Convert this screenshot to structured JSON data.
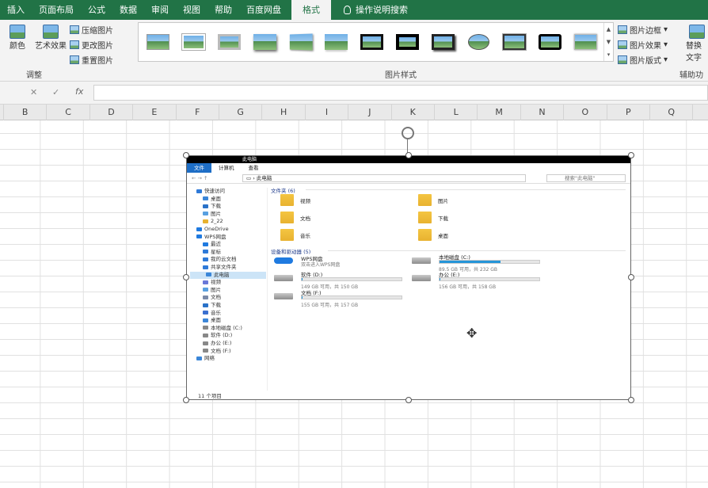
{
  "ribbon_tabs": [
    "插入",
    "页面布局",
    "公式",
    "数据",
    "审阅",
    "视图",
    "帮助",
    "百度网盘",
    "格式",
    "操作说明搜索"
  ],
  "active_tab_index": 8,
  "ribbon": {
    "adjust": {
      "color": "颜色",
      "art": "艺术效果",
      "compress": "压缩图片",
      "change": "更改图片",
      "reset": "重置图片",
      "label": "调整"
    },
    "styles_label": "图片样式",
    "right": {
      "border": "图片边框",
      "effects": "图片效果",
      "layout": "图片版式",
      "alt_text": "替换文字",
      "acc_label": "辅助功能"
    }
  },
  "formula_bar": {
    "fx": "fx",
    "cancel": "✕",
    "enter": "✓"
  },
  "columns": [
    "B",
    "C",
    "D",
    "E",
    "F",
    "G",
    "H",
    "I",
    "J",
    "K",
    "L",
    "M",
    "N",
    "O",
    "P",
    "Q",
    "R"
  ],
  "explorer": {
    "title": "此电脑",
    "tabs": [
      "文件",
      "计算机",
      "查看"
    ],
    "address": "此电脑",
    "search_placeholder": "搜索\"此电脑\"",
    "nav": [
      {
        "label": "快速访问",
        "indent": 0,
        "icon": "star-icon"
      },
      {
        "label": "桌面",
        "indent": 1,
        "icon": "desktop-icon"
      },
      {
        "label": "下载",
        "indent": 1,
        "icon": "download-icon"
      },
      {
        "label": "图片",
        "indent": 1,
        "icon": "pictures-icon"
      },
      {
        "label": "2_22",
        "indent": 1,
        "icon": "folder-icon"
      },
      {
        "label": "OneDrive",
        "indent": 0,
        "icon": "cloud-icon"
      },
      {
        "label": "WPS网盘",
        "indent": 0,
        "icon": "cloud-icon"
      },
      {
        "label": "最近",
        "indent": 1,
        "icon": "recent-icon"
      },
      {
        "label": "星标",
        "indent": 1,
        "icon": "star-icon"
      },
      {
        "label": "我的云文档",
        "indent": 1,
        "icon": "cloud-doc-icon"
      },
      {
        "label": "共享文件夹",
        "indent": 1,
        "icon": "share-icon"
      },
      {
        "label": "此电脑",
        "indent": 0,
        "icon": "pc-icon",
        "selected": true
      },
      {
        "label": "视频",
        "indent": 1,
        "icon": "video-icon"
      },
      {
        "label": "图片",
        "indent": 1,
        "icon": "pictures-icon"
      },
      {
        "label": "文档",
        "indent": 1,
        "icon": "documents-icon"
      },
      {
        "label": "下载",
        "indent": 1,
        "icon": "download-icon"
      },
      {
        "label": "音乐",
        "indent": 1,
        "icon": "music-icon"
      },
      {
        "label": "桌面",
        "indent": 1,
        "icon": "desktop-icon"
      },
      {
        "label": "本地磁盘 (C:)",
        "indent": 1,
        "icon": "drive-icon"
      },
      {
        "label": "软件 (D:)",
        "indent": 1,
        "icon": "drive-icon"
      },
      {
        "label": "办公 (E:)",
        "indent": 1,
        "icon": "drive-icon"
      },
      {
        "label": "文档 (F:)",
        "indent": 1,
        "icon": "drive-icon"
      },
      {
        "label": "网络",
        "indent": 0,
        "icon": "network-icon"
      }
    ],
    "folders_header": "文件夹 (6)",
    "folders": [
      "视频",
      "图片",
      "文档",
      "下载",
      "音乐",
      "桌面"
    ],
    "devices_header": "设备和驱动器 (5)",
    "drives": [
      {
        "name": "WPS网盘",
        "sub": "双击进入WPS网盘",
        "fill": 0,
        "bar": false
      },
      {
        "name": "本地磁盘 (C:)",
        "sub": "89.5 GB 可用，共 232 GB",
        "fill": 0.61,
        "bar": true
      },
      {
        "name": "软件 (D:)",
        "sub": "149 GB 可用，共 150 GB",
        "fill": 0.01,
        "bar": true
      },
      {
        "name": "办公 (E:)",
        "sub": "156 GB 可用，共 158 GB",
        "fill": 0.01,
        "bar": true
      },
      {
        "name": "文档 (F:)",
        "sub": "155 GB 可用，共 157 GB",
        "fill": 0.01,
        "bar": true
      }
    ],
    "status": "11 个项目"
  }
}
